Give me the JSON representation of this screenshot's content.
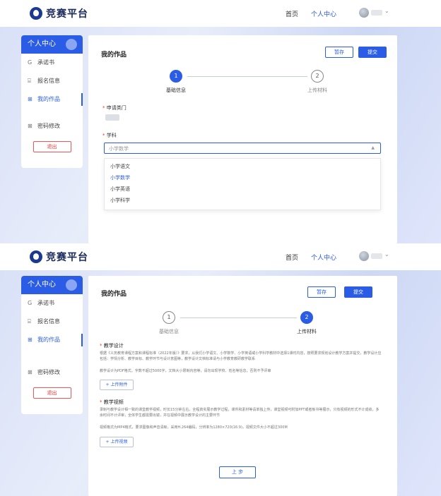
{
  "header": {
    "logo_text": "竞赛平台",
    "nav_home": "首页",
    "nav_center": "个人中心",
    "caret": "⌄"
  },
  "sidebar": {
    "title": "个人中心",
    "items": [
      {
        "icon": "G",
        "label": "承诺书"
      },
      {
        "icon": "⌸",
        "label": "报名信息"
      },
      {
        "icon": "⊞",
        "label": "我的作品"
      },
      {
        "icon": "⊠",
        "label": "密码修改"
      }
    ],
    "logout_a": "退出",
    "logout_b": "退出"
  },
  "main": {
    "title": "我的作品",
    "save": "暂存",
    "submit": "提交",
    "steps": [
      {
        "num": "1",
        "label": "基础信息"
      },
      {
        "num": "2",
        "label": "上传材料"
      }
    ]
  },
  "form": {
    "applicant_label": "申请类门",
    "subject_label": "学科",
    "subject_value": "小学数学",
    "options": [
      "小学语文",
      "小学数学",
      "小学英语",
      "小学科学"
    ],
    "selected_index": 1
  },
  "upload": {
    "design_title": "教学设计",
    "design_desc": "根据《义务教育课程方案和课程标准（2022年版）》要求，从我们小学语文、小学数学、小学英语或小学科学教材中选择1课时内容，按照要求规划设计教学方案并提交，教学设计应包括：学情分析、教学目标、教学环节与设计意图等，教学设计文档标准请与小学教育教研教学联系",
    "design_note": "教学设计为PDF格式，字数不超过5000字，文档大小限制内容等，请勿出现学校、姓名等信息，否则不予评审",
    "design_button": "+ 上传附件",
    "video_title": "教学视频",
    "video_desc": "录制与教学设计相一致的课堂教学视频，时长15分钟左右，全程真实展示教学过程，课件和素材等请单独上传，课堂视频可附加PPT或者板书等展示，只有视频的形式不计成绩，多余时间不计评审，全体学生都需要出镜，并在视频中展示教学设计的主要环节",
    "video_note": "视频格式为MP4格式，要求图像和声音清晰，采用H.264编码，分辨率为1280×720(16:9)，视频文件大小不超过300M",
    "video_button": "+ 上传视频",
    "prev": "上 步"
  },
  "colors": {
    "primary": "#2b5ce6",
    "danger": "#e33333",
    "background": "#dfe5f8"
  }
}
